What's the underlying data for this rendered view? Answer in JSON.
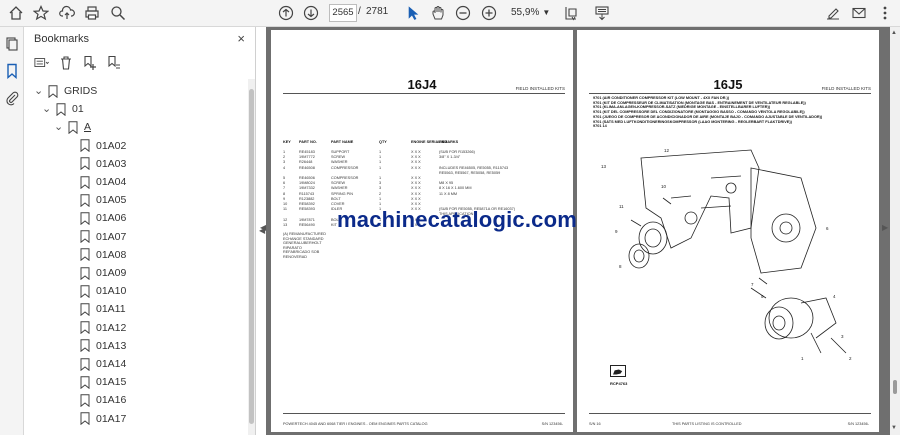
{
  "toolbar": {
    "current_page": "2565",
    "page_separator": "/",
    "total_pages": "2781",
    "zoom": "55,9%",
    "icons": [
      "home-icon",
      "bookmark-star-icon",
      "upload-icon",
      "print-icon",
      "search-zoom-icon",
      "page-up-icon",
      "page-down-icon",
      "select-cursor-icon",
      "hand-icon",
      "zoom-out-icon",
      "zoom-in-icon",
      "fit-page-icon",
      "read-mode-icon",
      "edit-sign-icon",
      "mail-icon",
      "more-icon"
    ]
  },
  "bookmarks": {
    "title": "Bookmarks",
    "close_label": "×",
    "tree": [
      {
        "label": "GRIDS",
        "level": 0,
        "expanded": true,
        "underline": false
      },
      {
        "label": "01",
        "level": 1,
        "expanded": true,
        "underline": false
      },
      {
        "label": "A",
        "level": 2,
        "expanded": true,
        "underline": true
      },
      {
        "label": "01A02",
        "level": 3,
        "underline": false
      },
      {
        "label": "01A03",
        "level": 3,
        "underline": false
      },
      {
        "label": "01A04",
        "level": 3,
        "underline": false
      },
      {
        "label": "01A05",
        "level": 3,
        "underline": false
      },
      {
        "label": "01A06",
        "level": 3,
        "underline": false
      },
      {
        "label": "01A07",
        "level": 3,
        "underline": false
      },
      {
        "label": "01A08",
        "level": 3,
        "underline": false
      },
      {
        "label": "01A09",
        "level": 3,
        "underline": false
      },
      {
        "label": "01A10",
        "level": 3,
        "underline": false
      },
      {
        "label": "01A11",
        "level": 3,
        "underline": false
      },
      {
        "label": "01A12",
        "level": 3,
        "underline": false
      },
      {
        "label": "01A13",
        "level": 3,
        "underline": false
      },
      {
        "label": "01A14",
        "level": 3,
        "underline": false
      },
      {
        "label": "01A15",
        "level": 3,
        "underline": false
      },
      {
        "label": "01A16",
        "level": 3,
        "underline": false
      },
      {
        "label": "01A17",
        "level": 3,
        "underline": false
      }
    ]
  },
  "document": {
    "left_page": {
      "title": "16J4",
      "header_right": "FIELD INSTALLED KITS",
      "col_headers": [
        "KEY",
        "PART NO.",
        "PART NAME",
        "QTY",
        "ENGINE SERIAL NO.",
        "REMARKS"
      ],
      "rows": [
        [
          "1",
          "RE45183",
          "SUPPORT",
          "1",
          "X X X",
          "(SUB FOR R153266)"
        ],
        [
          "2",
          "19M7772",
          "SCREW",
          "1",
          "X X X",
          "3/8\" X 1-3/4\""
        ],
        [
          "3",
          "R26448",
          "WASHER",
          "1",
          "X X X",
          ""
        ],
        [
          "4",
          "RE46508",
          "COMPRESSOR",
          "1",
          "X X X",
          "INCLUDES RE46505, RE5055, R115743"
        ],
        [
          "",
          "",
          "",
          "",
          "",
          "RE5563, RE5567, RE5058, RE5059"
        ],
        [
          "5",
          "RE46506",
          "COMPRESSOR",
          "1",
          "X X X",
          ""
        ],
        [
          "6",
          "19M8024",
          "SCREW",
          "3",
          "X X X",
          "M8 X 95"
        ],
        [
          "7",
          "19M7332",
          "WASHER",
          "3",
          "X X X",
          "8 X 16 X 1.600 MM"
        ],
        [
          "8",
          "R115743",
          "SPRING PIN",
          "2",
          "X X X",
          "11 X 8 MM"
        ],
        [
          "9",
          "R123882",
          "BOLT",
          "1",
          "X X X",
          ""
        ],
        [
          "10",
          "RE58392",
          "COVER",
          "1",
          "X X X",
          ""
        ],
        [
          "11",
          "RE58393",
          "IDLER",
          "1",
          "X X X",
          "(SUB FOR RE5055, RE5871A OR RE16037)"
        ],
        [
          "",
          "",
          "",
          "",
          "",
          "THIS APPLICATION"
        ],
        [
          "12",
          "19M7871",
          "BOLT",
          "1",
          "X X X",
          ""
        ],
        [
          "13",
          "RE56490",
          "KIT",
          "1",
          "X X X",
          ""
        ]
      ],
      "notes": [
        "(A) REMANUFACTURED",
        "ECHANGE STANDARD",
        "GENERALUBERHOLT",
        "RIPARATO",
        "REFABRICADO SOB",
        "RENOVERAD"
      ],
      "footer_left": "POWERTECH 4045 AND 6068 TIER I ENGINES - OEM ENGINES PARTS CATALOG",
      "footer_right": "S/N 123456-"
    },
    "right_page": {
      "title": "16J5",
      "header_right": "FIELD INSTALLED KITS",
      "desc_lines": [
        "9701 (AIR CONDITIONER COMPRESSOR KIT (LOW MOUNT - 4XX FAN DR.))",
        "9701 (KIT DE COMPRESSEUR DE CLIMATISATION (MONTAGE BAS - ENTRAINEMENT DE VENTILATEUR REGLABLE))",
        "9701 (KLIMA-ANLAGEN-KOMPRESSOR-SATZ (NIEDRIGE MONTAGE - EINSTELLBARER LUFTER))",
        "9701 (KIT DEL COMPRESSORE DEL CONDIZIONATORE (MONTAGGIO BASSO - COMANDO VENTOLA REGOLABILE))",
        "9701 (JUEGO DE COMPRESOR DE ACONDICIONADOR DE AIRE (MONTAJE BAJO - COMANDO AJUSTABLE DE VENTILADOR))",
        "9701 (SATS MED LUFTKONDITIONERINGSKOMPRESSOR (LAAG MONTERING - REGLERBART FLAKTDRIVE))",
        "9701  14"
      ],
      "callouts": [
        "13",
        "12",
        "11",
        "10",
        "9",
        "8",
        "7",
        "6",
        "5",
        "4",
        "3",
        "2",
        "1"
      ],
      "figure_ref": "RCP4763",
      "footer_left": "S/N 16",
      "footer_mid": "THIS PARTS LISTING IS CONTROLLED",
      "footer_right": "S/N 123456-"
    },
    "watermark": "machinecatalogic.com"
  }
}
